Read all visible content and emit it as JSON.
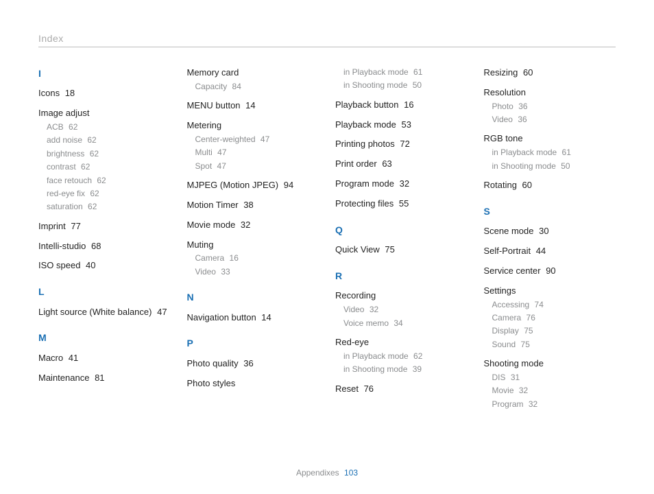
{
  "header": "Index",
  "footer": {
    "label": "Appendixes",
    "page": "103"
  },
  "columns": [
    [
      {
        "type": "letter",
        "text": "I",
        "first": true
      },
      {
        "type": "entry",
        "label": "Icons",
        "page": "18"
      },
      {
        "type": "group",
        "label": "Image adjust",
        "subs": [
          {
            "label": "ACB",
            "page": "62"
          },
          {
            "label": "add noise",
            "page": "62"
          },
          {
            "label": "brightness",
            "page": "62"
          },
          {
            "label": "contrast",
            "page": "62"
          },
          {
            "label": "face retouch",
            "page": "62"
          },
          {
            "label": "red-eye fix",
            "page": "62"
          },
          {
            "label": "saturation",
            "page": "62"
          }
        ]
      },
      {
        "type": "entry",
        "label": "Imprint",
        "page": "77"
      },
      {
        "type": "entry",
        "label": "Intelli-studio",
        "page": "68"
      },
      {
        "type": "entry",
        "label": "ISO speed",
        "page": "40"
      },
      {
        "type": "letter",
        "text": "L"
      },
      {
        "type": "entry",
        "label": "Light source (White balance)",
        "page": "47"
      },
      {
        "type": "letter",
        "text": "M"
      },
      {
        "type": "entry",
        "label": "Macro",
        "page": "41"
      },
      {
        "type": "entry",
        "label": "Maintenance",
        "page": "81"
      }
    ],
    [
      {
        "type": "group",
        "label": "Memory card",
        "first": true,
        "subs": [
          {
            "label": "Capacity",
            "page": "84"
          }
        ]
      },
      {
        "type": "entry",
        "label": "MENU button",
        "page": "14"
      },
      {
        "type": "group",
        "label": "Metering",
        "subs": [
          {
            "label": "Center-weighted",
            "page": "47"
          },
          {
            "label": "Multi",
            "page": "47"
          },
          {
            "label": "Spot",
            "page": "47"
          }
        ]
      },
      {
        "type": "entry",
        "label": "MJPEG (Motion JPEG)",
        "page": "94"
      },
      {
        "type": "entry",
        "label": "Motion Timer",
        "page": "38"
      },
      {
        "type": "entry",
        "label": "Movie mode",
        "page": "32"
      },
      {
        "type": "group",
        "label": "Muting",
        "subs": [
          {
            "label": "Camera",
            "page": "16"
          },
          {
            "label": "Video",
            "page": "33"
          }
        ]
      },
      {
        "type": "letter",
        "text": "N"
      },
      {
        "type": "entry",
        "label": "Navigation button",
        "page": "14"
      },
      {
        "type": "letter",
        "text": "P"
      },
      {
        "type": "entry",
        "label": "Photo quality",
        "page": "36"
      },
      {
        "type": "entry",
        "label": "Photo styles",
        "page": ""
      }
    ],
    [
      {
        "type": "subonly",
        "first": true,
        "subs": [
          {
            "label": "in Playback mode",
            "page": "61"
          },
          {
            "label": "in Shooting mode",
            "page": "50"
          }
        ]
      },
      {
        "type": "entry",
        "label": "Playback button",
        "page": "16"
      },
      {
        "type": "entry",
        "label": "Playback mode",
        "page": "53"
      },
      {
        "type": "entry",
        "label": "Printing photos",
        "page": "72"
      },
      {
        "type": "entry",
        "label": "Print order",
        "page": "63"
      },
      {
        "type": "entry",
        "label": "Program mode",
        "page": "32"
      },
      {
        "type": "entry",
        "label": "Protecting files",
        "page": "55"
      },
      {
        "type": "letter",
        "text": "Q"
      },
      {
        "type": "entry",
        "label": "Quick View",
        "page": "75"
      },
      {
        "type": "letter",
        "text": "R"
      },
      {
        "type": "group",
        "label": "Recording",
        "subs": [
          {
            "label": "Video",
            "page": "32"
          },
          {
            "label": "Voice memo",
            "page": "34"
          }
        ]
      },
      {
        "type": "group",
        "label": "Red-eye",
        "subs": [
          {
            "label": "in Playback mode",
            "page": "62"
          },
          {
            "label": "in Shooting mode",
            "page": "39"
          }
        ]
      },
      {
        "type": "entry",
        "label": "Reset",
        "page": "76"
      }
    ],
    [
      {
        "type": "entry",
        "label": "Resizing",
        "page": "60",
        "first": true
      },
      {
        "type": "group",
        "label": "Resolution",
        "subs": [
          {
            "label": "Photo",
            "page": "36"
          },
          {
            "label": "Video",
            "page": "36"
          }
        ]
      },
      {
        "type": "group",
        "label": "RGB tone",
        "subs": [
          {
            "label": "in Playback mode",
            "page": "61"
          },
          {
            "label": "in Shooting mode",
            "page": "50"
          }
        ]
      },
      {
        "type": "entry",
        "label": "Rotating",
        "page": "60"
      },
      {
        "type": "letter",
        "text": "S"
      },
      {
        "type": "entry",
        "label": "Scene mode",
        "page": "30"
      },
      {
        "type": "entry",
        "label": "Self-Portrait",
        "page": "44"
      },
      {
        "type": "entry",
        "label": "Service center",
        "page": "90"
      },
      {
        "type": "group",
        "label": "Settings",
        "subs": [
          {
            "label": "Accessing",
            "page": "74"
          },
          {
            "label": "Camera",
            "page": "76"
          },
          {
            "label": "Display",
            "page": "75"
          },
          {
            "label": "Sound",
            "page": "75"
          }
        ]
      },
      {
        "type": "group",
        "label": "Shooting mode",
        "subs": [
          {
            "label": "DIS",
            "page": "31"
          },
          {
            "label": "Movie",
            "page": "32"
          },
          {
            "label": "Program",
            "page": "32"
          }
        ]
      }
    ]
  ]
}
